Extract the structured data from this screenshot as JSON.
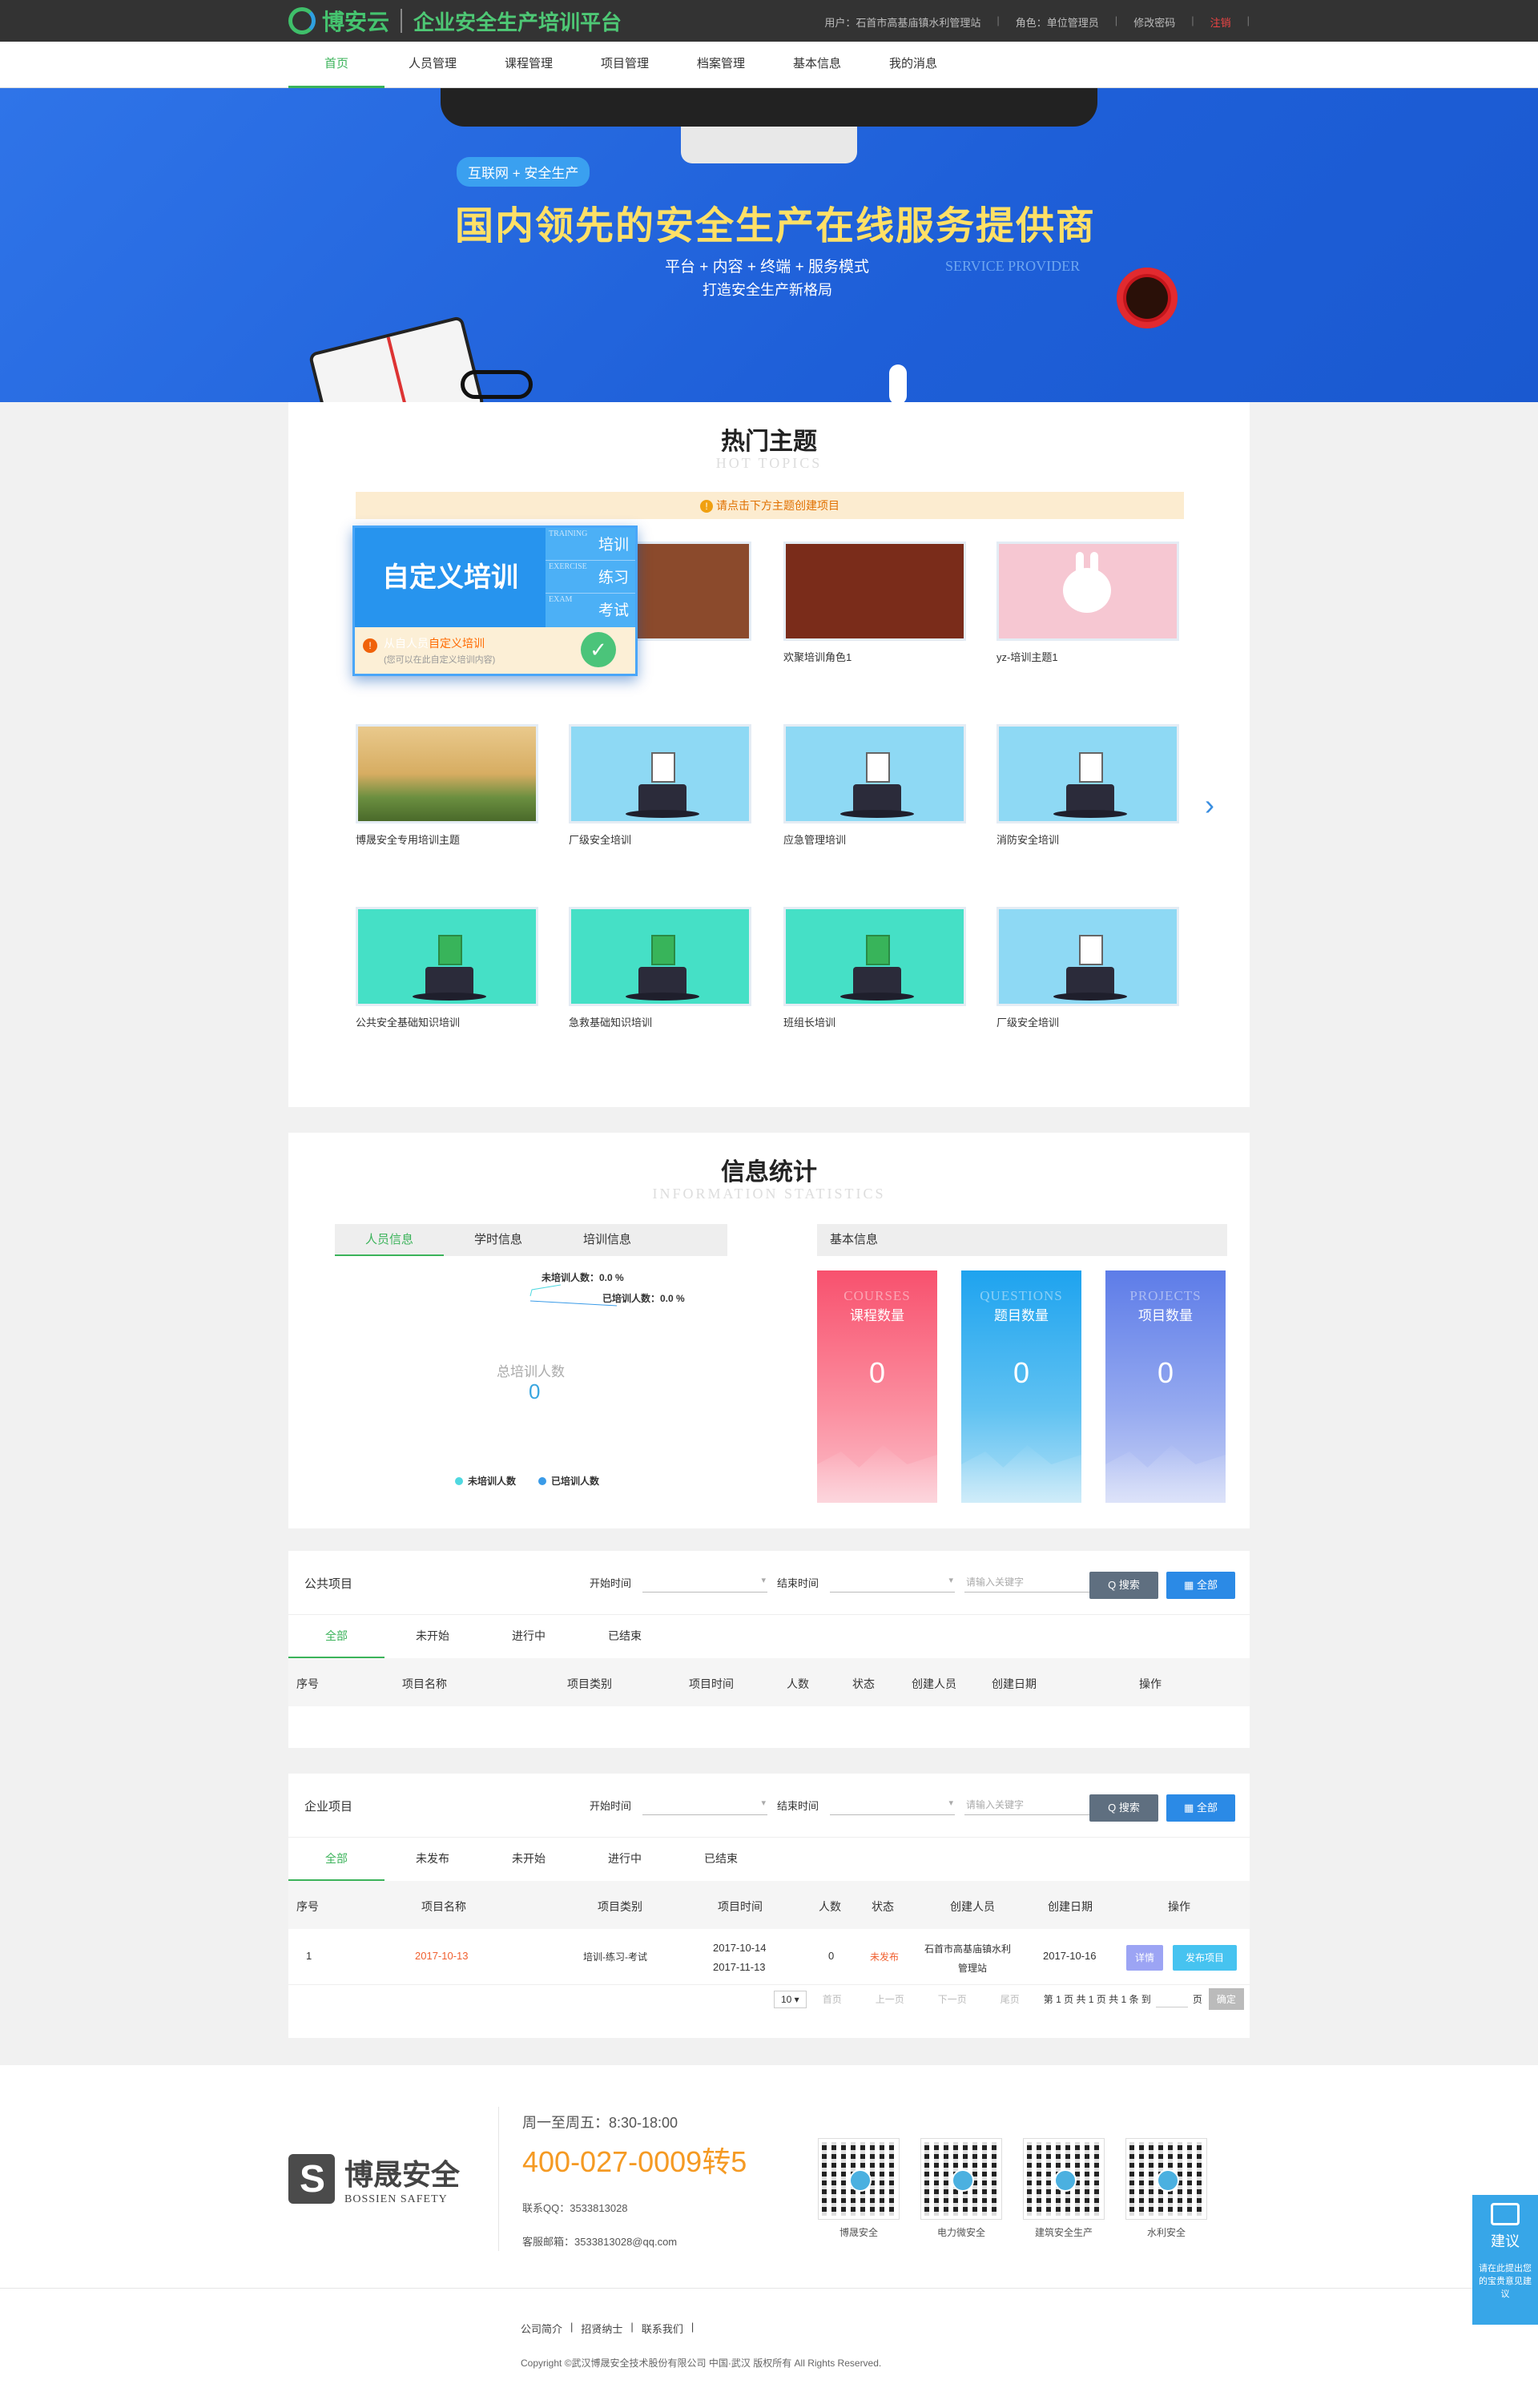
{
  "header": {
    "brand": "博安云",
    "title": "企业安全生产培训平台",
    "user": "用户：石首市高基庙镇水利管理站",
    "role": "角色：单位管理员",
    "change_pwd": "修改密码",
    "logout": "注销",
    "separator": "|"
  },
  "nav": [
    "首页",
    "人员管理",
    "课程管理",
    "项目管理",
    "档案管理",
    "基本信息",
    "我的消息"
  ],
  "banner": {
    "tag": "互联网 + 安全生产",
    "title": "国内领先的安全生产在线服务提供商",
    "line1": "平台 + 内容 + 终端 + 服务模式",
    "line2": "打造安全生产新格局",
    "english": "SERVICE PROVIDER"
  },
  "topics": {
    "title": "热门主题",
    "subtitle": "HOT TOPICS",
    "notice": "请点击下方主题创建项目",
    "notice_icon": "!",
    "custom": {
      "title": "自定义培训",
      "items": [
        {
          "en": "TRAINING",
          "cn": "培训"
        },
        {
          "en": "EXERCISE",
          "cn": "练习"
        },
        {
          "en": "EXAM",
          "cn": "考试"
        }
      ],
      "line1_prefix": "从自人员",
      "line1_em": "自定义培训",
      "line2": "(您可以在此自定义培训内容)",
      "warn": "!",
      "check": "✓"
    },
    "items": [
      {
        "label": "2"
      },
      {
        "label": "欢聚培训角色1"
      },
      {
        "label": "yz-培训主题1"
      },
      {
        "label": "博晟安全专用培训主题"
      },
      {
        "label": "厂级安全培训"
      },
      {
        "label": "应急管理培训"
      },
      {
        "label": "消防安全培训"
      },
      {
        "label": "公共安全基础知识培训"
      },
      {
        "label": "急救基础知识培训"
      },
      {
        "label": "班组长培训"
      },
      {
        "label": "厂级安全培训"
      }
    ],
    "next_arrow": "›"
  },
  "stats": {
    "title": "信息统计",
    "subtitle": "INFORMATION STATISTICS",
    "tabs": [
      "人员信息",
      "学时信息",
      "培训信息"
    ],
    "pie": {
      "untrained": "未培训人数：0.0 %",
      "trained": "已培训人数：0.0 %",
      "total_label": "总培训人数",
      "total": "0",
      "legend_untrained": "未培训人数",
      "legend_trained": "已培训人数",
      "colors": {
        "untrained": "#4fd8e0",
        "trained": "#3a9be8"
      }
    },
    "base_header": "基本信息",
    "cards": [
      {
        "en": "COURSES",
        "cn": "课程数量",
        "value": "0",
        "color": "#f76a80"
      },
      {
        "en": "QUESTIONS",
        "cn": "题目数量",
        "value": "0",
        "color": "#2aa8ef"
      },
      {
        "en": "PROJECTS",
        "cn": "项目数量",
        "value": "0",
        "color": "#6a86ea"
      }
    ]
  },
  "public": {
    "label": "公共项目",
    "start": "开始时间",
    "end": "结束时间",
    "keyword_ph": "请输入关键字",
    "search": "Q 搜索",
    "all": "▦ 全部",
    "tabs": [
      "全部",
      "未开始",
      "进行中",
      "已结束"
    ],
    "columns": [
      "序号",
      "项目名称",
      "项目类别",
      "项目时间",
      "人数",
      "状态",
      "创建人员",
      "创建日期",
      "操作"
    ]
  },
  "enterprise": {
    "label": "企业项目",
    "start": "开始时间",
    "end": "结束时间",
    "keyword_ph": "请输入关键字",
    "search": "Q 搜索",
    "all": "▦ 全部",
    "tabs": [
      "全部",
      "未发布",
      "未开始",
      "进行中",
      "已结束"
    ],
    "columns": [
      "序号",
      "项目名称",
      "项目类别",
      "项目时间",
      "人数",
      "状态",
      "创建人员",
      "创建日期",
      "操作"
    ],
    "rows": [
      {
        "no": "1",
        "name": "2017-10-13",
        "type": "培训-练习-考试",
        "start": "2017-10-14",
        "end": "2017-11-13",
        "count": "0",
        "status": "未发布",
        "creator1": "石首市高基庙镇水利",
        "creator2": "管理站",
        "date": "2017-10-16",
        "detail": "详情",
        "publish": "发布项目"
      }
    ],
    "pager": {
      "size": "10 ▾",
      "first": "首页",
      "prev": "上一页",
      "next": "下一页",
      "last": "尾页",
      "info": "第 1 页  共 1 页  共 1 条 到",
      "page": "页",
      "ok": "确定"
    }
  },
  "footer": {
    "brand_cn": "博晟安全",
    "brand_en": "BOSSIEN SAFETY",
    "hours": "周一至周五：8:30-18:00",
    "phone": "400-027-0009转5",
    "qq": "联系QQ：3533813028",
    "mail": "客服邮箱：3533813028@qq.com",
    "qrcodes": [
      "博晟安全",
      "电力微安全",
      "建筑安全生产",
      "水利安全"
    ],
    "links": [
      "公司简介",
      "|",
      "招贤纳士",
      "|",
      "联系我们",
      "|"
    ],
    "copyright": "Copyright ©武汉博晟安全技术股份有限公司 中国·武汉 版权所有 All Rights Reserved."
  },
  "suggest": {
    "title": "建议",
    "desc": "请在此提出您的宝贵意见建议"
  }
}
